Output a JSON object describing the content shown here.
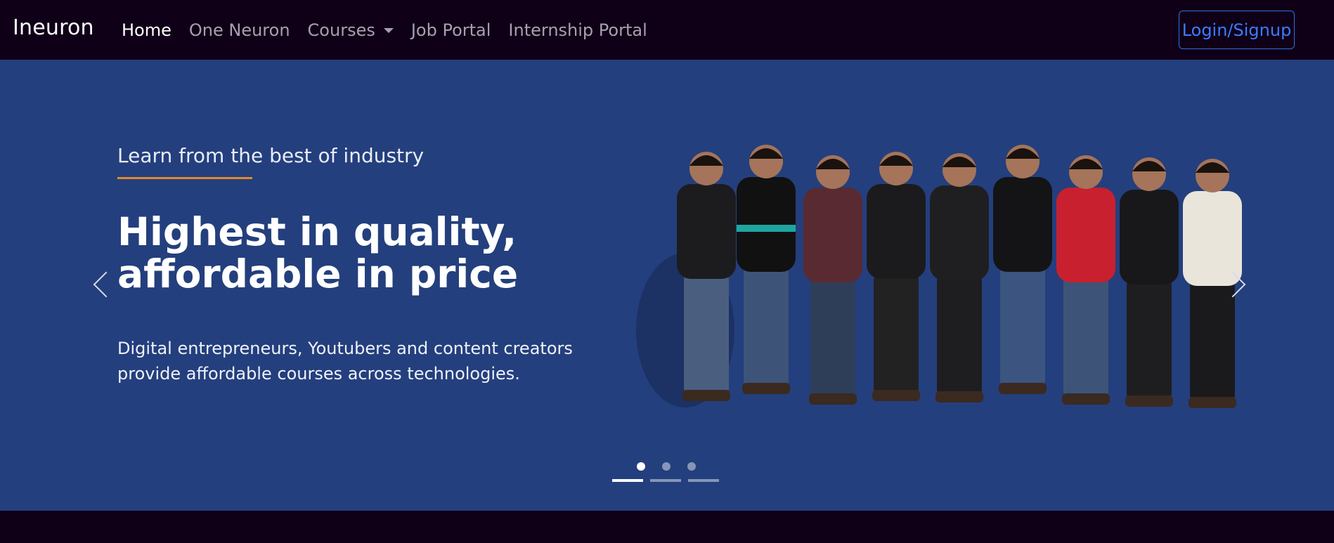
{
  "navbar": {
    "brand": "Ineuron",
    "links": [
      {
        "label": "Home",
        "active": true
      },
      {
        "label": "One Neuron",
        "active": false
      },
      {
        "label": "Courses",
        "active": false,
        "has_dropdown": true
      },
      {
        "label": "Job Portal",
        "active": false
      },
      {
        "label": "Internship Portal",
        "active": false
      }
    ],
    "login_label": "Login/Signup"
  },
  "hero": {
    "eyebrow": "Learn from the best of industry",
    "headline_line1": "Highest in quality,",
    "headline_line2": "affordable in price",
    "description_line1": "Digital entrepreneurs, Youtubers and content creators",
    "description_line2": "provide affordable courses across technologies.",
    "image_alt": "team-group-photo",
    "carousel": {
      "slide_count": 3,
      "active_index": 0
    }
  },
  "colors": {
    "nav_bg": "#0f0018",
    "hero_bg": "#243f7d",
    "accent_line": "#e08a2d",
    "login_border": "#2f6fe8"
  }
}
